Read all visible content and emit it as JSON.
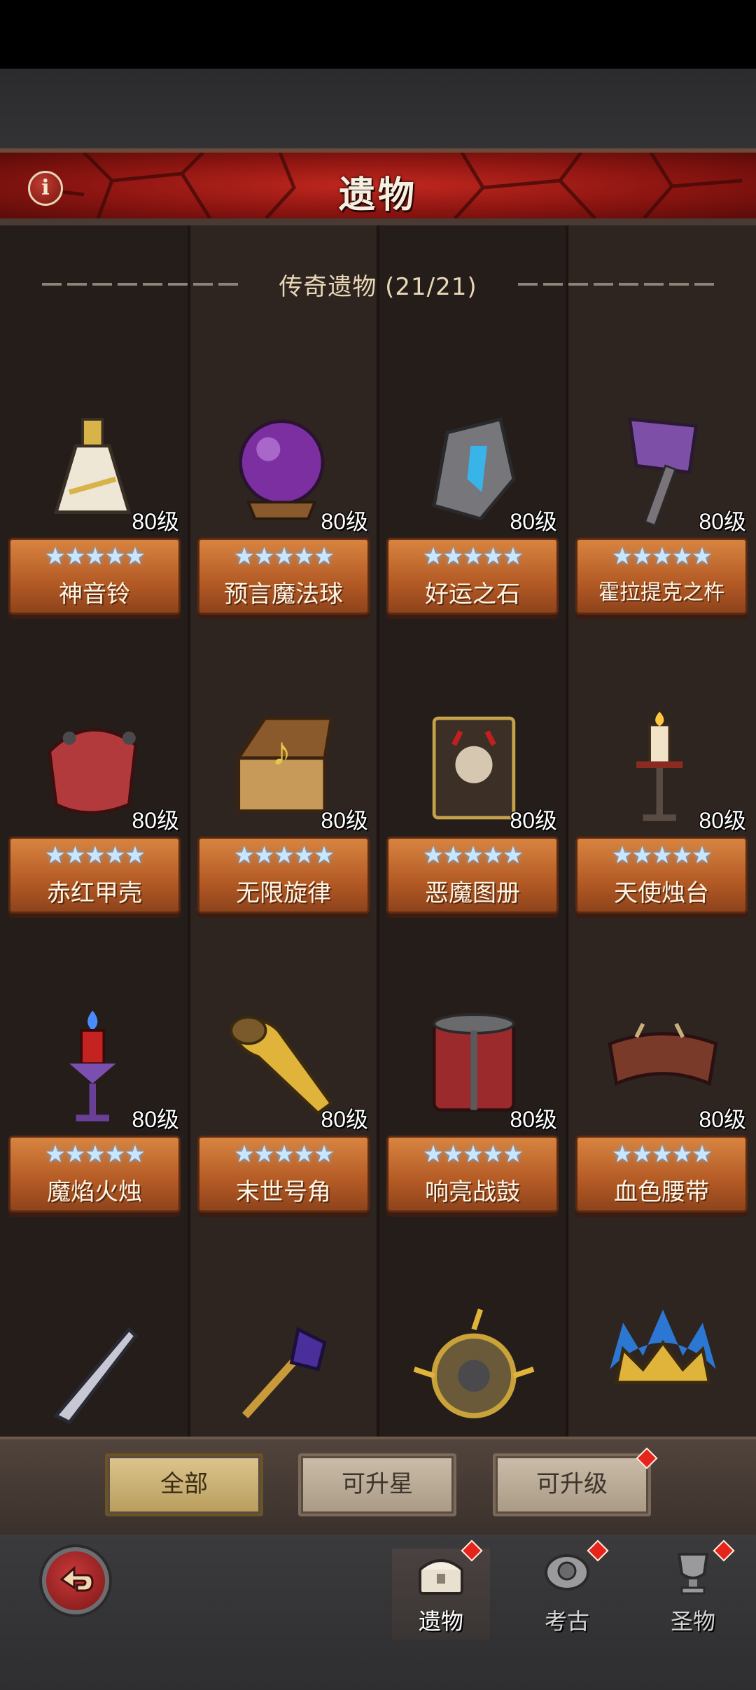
{
  "header": {
    "title": "遗物",
    "info_icon": "i"
  },
  "section": {
    "title": "传奇遗物 (21/21)"
  },
  "items": [
    {
      "name": "神音铃",
      "level": "80级",
      "stars": "★★★★★",
      "icon": "bell-icon"
    },
    {
      "name": "预言魔法球",
      "level": "80级",
      "stars": "★★★★★",
      "icon": "crystal-ball-icon"
    },
    {
      "name": "好运之石",
      "level": "80级",
      "stars": "★★★★★",
      "icon": "rune-stone-icon"
    },
    {
      "name": "霍拉提克之杵",
      "level": "80级",
      "stars": "★★★★★",
      "icon": "hammer-icon"
    },
    {
      "name": "赤红甲壳",
      "level": "80级",
      "stars": "★★★★★",
      "icon": "red-shell-icon"
    },
    {
      "name": "无限旋律",
      "level": "80级",
      "stars": "★★★★★",
      "icon": "music-box-icon"
    },
    {
      "name": "恶魔图册",
      "level": "80级",
      "stars": "★★★★★",
      "icon": "demon-book-icon"
    },
    {
      "name": "天使烛台",
      "level": "80级",
      "stars": "★★★★★",
      "icon": "candlestick-icon"
    },
    {
      "name": "魔焰火烛",
      "level": "80级",
      "stars": "★★★★★",
      "icon": "blue-flame-candle-icon"
    },
    {
      "name": "末世号角",
      "level": "80级",
      "stars": "★★★★★",
      "icon": "horn-icon"
    },
    {
      "name": "响亮战鼓",
      "level": "80级",
      "stars": "★★★★★",
      "icon": "war-drum-icon"
    },
    {
      "name": "血色腰带",
      "level": "80级",
      "stars": "★★★★★",
      "icon": "belt-icon"
    },
    {
      "name": "",
      "level": "",
      "stars": "",
      "icon": "sword-icon"
    },
    {
      "name": "",
      "level": "",
      "stars": "",
      "icon": "scepter-icon"
    },
    {
      "name": "",
      "level": "",
      "stars": "",
      "icon": "spiked-orb-icon"
    },
    {
      "name": "",
      "level": "",
      "stars": "",
      "icon": "blue-crown-icon"
    }
  ],
  "filters": [
    {
      "label": "全部",
      "active": true,
      "badge": false
    },
    {
      "label": "可升星",
      "active": false,
      "badge": false
    },
    {
      "label": "可升级",
      "active": false,
      "badge": true
    }
  ],
  "nav": {
    "back_icon": "back-arrow-icon",
    "tabs": [
      {
        "label": "遗物",
        "icon": "relic-chest-icon",
        "active": true,
        "badge": true
      },
      {
        "label": "考古",
        "icon": "archaeology-icon",
        "active": false,
        "badge": true
      },
      {
        "label": "圣物",
        "icon": "trophy-icon",
        "active": false,
        "badge": true
      }
    ]
  },
  "colors": {
    "banner_red": "#c1281f",
    "plate_orange": "#d88440",
    "star_blue": "#c9e6ff",
    "badge_red": "#e5241c"
  }
}
